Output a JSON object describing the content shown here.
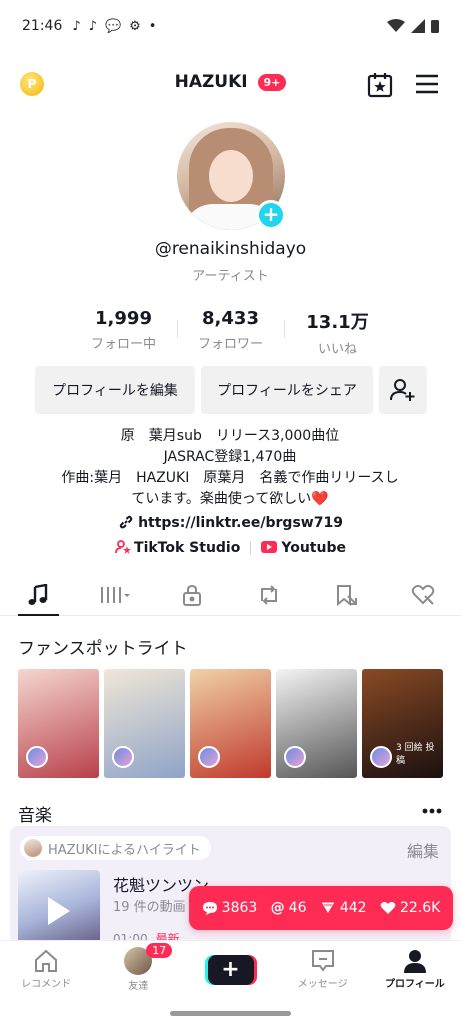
{
  "status_bar": {
    "time": "21:46",
    "dot": "•"
  },
  "header": {
    "coin_label": "P",
    "title": "HAZUKI",
    "badge": "9+"
  },
  "profile": {
    "username": "@renaikinshidayo",
    "subtitle": "アーティスト",
    "stats": [
      {
        "value": "1,999",
        "label": "フォロー中"
      },
      {
        "value": "8,433",
        "label": "フォロワー"
      },
      {
        "value": "13.1万",
        "label": "いいね"
      }
    ],
    "edit_label": "プロフィールを編集",
    "share_label": "プロフィールをシェア",
    "bio_lines": [
      "原　葉月sub　リリース3,000曲位",
      "JASRAC登録1,470曲",
      "作曲:葉月　HAZUKI　原葉月　名義で作曲リリースし",
      "ています。楽曲使って欲しい❤️"
    ],
    "link": "https://linktr.ee/brgsw719",
    "studio_label": "TikTok Studio",
    "youtube_label": "Youtube"
  },
  "fans_spotlight": {
    "title": "ファンスポットライト",
    "thumbs": [
      {
        "colors": [
          "#f5d7d0",
          "#b8404a"
        ],
        "caption": ""
      },
      {
        "colors": [
          "#f1e7d6",
          "#8fa3c8"
        ],
        "caption": ""
      },
      {
        "colors": [
          "#f0d2a8",
          "#c0392b"
        ],
        "caption": ""
      },
      {
        "colors": [
          "#f4f4f4",
          "#555555"
        ],
        "caption": ""
      },
      {
        "colors": [
          "#8a4a24",
          "#1a1010"
        ],
        "caption": "3 回絵 投稿"
      }
    ]
  },
  "music": {
    "title": "音楽",
    "highlight_label": "HAZUKIによるハイライト",
    "edit_label": "編集",
    "track_name": "花魁ツンツン",
    "track_count": "19 件の動画",
    "track_time": "01:00",
    "track_new": "最新"
  },
  "notification": {
    "comments": "3863",
    "mentions": "46",
    "shares": "442",
    "likes": "22.6K"
  },
  "bottom_nav": {
    "home": "レコメンド",
    "friends": "友達",
    "friends_badge": "17",
    "create": "+",
    "inbox": "メッセージ",
    "profile": "プロフィール"
  },
  "colors": {
    "accent": "#fe2c55",
    "cyan": "#20d5ec",
    "text": "#161823",
    "muted": "#8a8b91"
  }
}
